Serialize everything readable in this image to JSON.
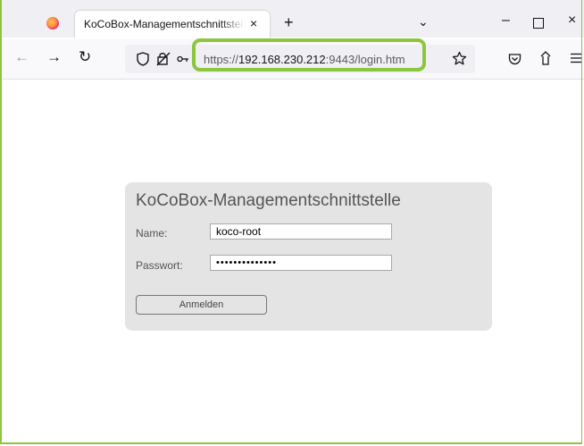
{
  "browser": {
    "tab_title": "KoCoBox-Managementschnittstelle",
    "tab_close": "×",
    "new_tab": "+",
    "tab_list": "⌄",
    "minimize": "–",
    "close": "×"
  },
  "nav": {
    "back": "←",
    "forward": "→",
    "reload": "↻",
    "url_scheme": "https://",
    "url_host": "192.168.230.212",
    "url_rest": ":9443/login.htm",
    "icons": [
      "shield-icon",
      "lock-icon",
      "permissions-icon",
      "star-icon",
      "pocket-icon",
      "share-icon",
      "menu-icon"
    ],
    "accent": "#8cc63f"
  },
  "login": {
    "title": "KoCoBox-Managementschnittstelle",
    "name_label": "Name:",
    "name_value": "koco-root",
    "password_label": "Passwort:",
    "password_value": "••••••••••••••",
    "submit_label": "Anmelden"
  }
}
